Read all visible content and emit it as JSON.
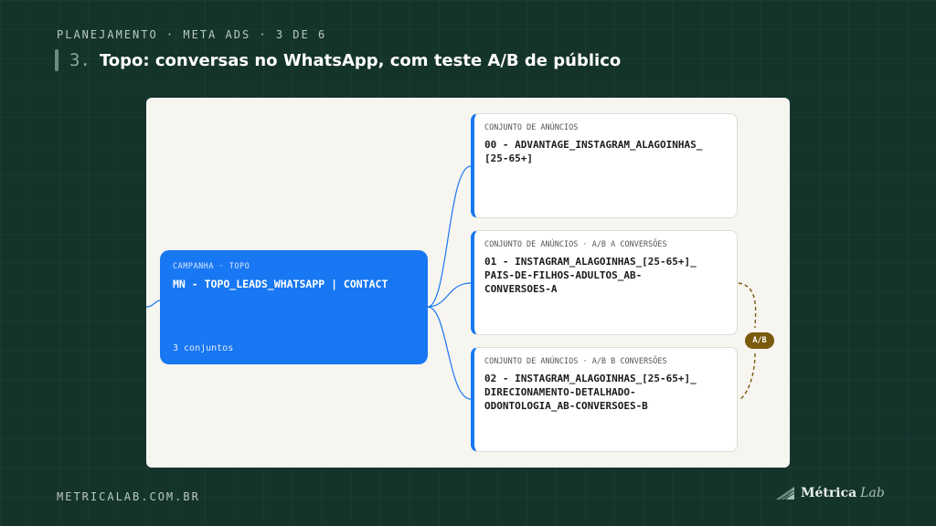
{
  "header": {
    "kicker": "PLANEJAMENTO · META ADS · 3 DE 6",
    "number": "3.",
    "title": "Topo: conversas no WhatsApp, com teste A/B de público"
  },
  "campaign": {
    "label": "CAMPANHA · TOPO",
    "name": "MN - TOPO_LEADS_WHATSAPP | CONTACT",
    "count": "3 conjuntos"
  },
  "adsets": [
    {
      "label": "CONJUNTO DE ANÚNCIOS",
      "name": "00 - ADVANTAGE_INSTAGRAM_ALAGOINHAS_\n[25-65+]"
    },
    {
      "label": "CONJUNTO DE ANÚNCIOS · A/B A CONVERSÕES",
      "name": "01 - INSTAGRAM_ALAGOINHAS_[25-65+]_\nPAIS-DE-FILHOS-ADULTOS_AB-\nCONVERSOES-A"
    },
    {
      "label": "CONJUNTO DE ANÚNCIOS · A/B B CONVERSÕES",
      "name": "02 - INSTAGRAM_ALAGOINHAS_[25-65+]_\nDIRECIONAMENTO-DETALHADO-\nODONTOLOGIA_AB-CONVERSOES-B"
    }
  ],
  "ab_badge": "A/B",
  "footer": {
    "url": "METRICALAB.COM.BR",
    "brand_main": "Métrica",
    "brand_sub": "Lab"
  },
  "colors": {
    "background": "#14332b",
    "accent_blue": "#1877f2",
    "ab_gold": "#7a5a0c",
    "panel": "#f7f5f0"
  }
}
